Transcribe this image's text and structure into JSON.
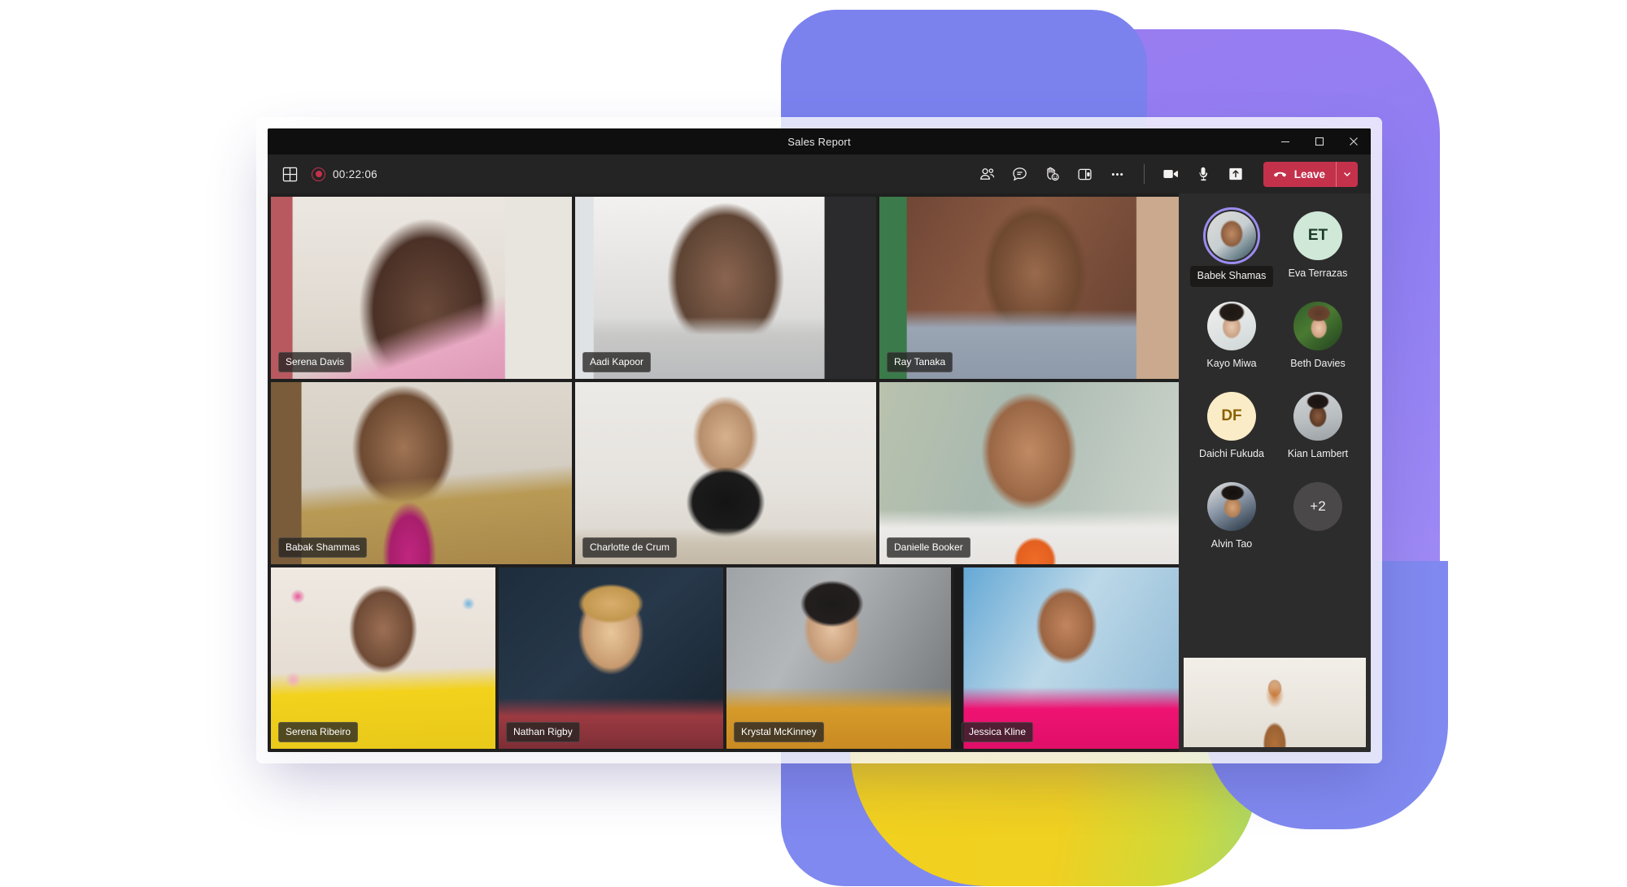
{
  "window": {
    "title": "Sales Report",
    "controls": [
      {
        "name": "minimize",
        "glyph": "minimize-icon"
      },
      {
        "name": "maximize",
        "glyph": "maximize-icon"
      },
      {
        "name": "close",
        "glyph": "close-icon"
      }
    ]
  },
  "toolbar": {
    "grid_view_icon": "grid-view-icon",
    "recording_icon": "record-icon",
    "elapsed_time": "00:22:06",
    "actions": [
      {
        "name": "people-icon",
        "label": "People"
      },
      {
        "name": "chat-icon",
        "label": "Chat"
      },
      {
        "name": "reactions-icon",
        "label": "Reactions"
      },
      {
        "name": "rooms-icon",
        "label": "Breakout rooms"
      },
      {
        "name": "more-icon",
        "label": "More actions"
      }
    ],
    "media": [
      {
        "name": "camera-icon",
        "label": "Camera"
      },
      {
        "name": "microphone-icon",
        "label": "Microphone"
      },
      {
        "name": "share-icon",
        "label": "Share"
      }
    ],
    "leave_label": "Leave",
    "leave_icon": "hangup-icon",
    "leave_dropdown_icon": "chevron-down-icon",
    "leave_color": "#c4314b"
  },
  "video_grid": {
    "rows": [
      [
        {
          "name": "Serena Davis",
          "bg": "#cfc4bc"
        },
        {
          "name": "Aadi Kapoor",
          "bg": "#b9bbbd"
        },
        {
          "name": "Ray Tanaka",
          "bg": "#7e5a48"
        }
      ],
      [
        {
          "name": "Babak Shammas",
          "bg": "#9a8b74"
        },
        {
          "name": "Charlotte de Crum",
          "bg": "#cfcac4"
        },
        {
          "name": "Danielle Booker",
          "bg": "#a6b0a4"
        }
      ],
      [
        {
          "name": "Serena Ribeiro",
          "bg": "#d8cfc5"
        },
        {
          "name": "Nathan Rigby",
          "bg": "#22303f"
        },
        {
          "name": "Krystal McKinney",
          "bg": "#8a8c8e"
        },
        {
          "name": "Jessica Kline",
          "bg": "#7fa8c9"
        }
      ]
    ]
  },
  "roster": {
    "participants": [
      {
        "name": "Babek Shamas",
        "type": "photo",
        "speaking": true,
        "label_style": "pill"
      },
      {
        "name": "Eva Terrazas",
        "type": "initials",
        "initials": "ET",
        "bg": "#cfe8d8",
        "fg": "#1b3a28"
      },
      {
        "name": "Kayo Miwa",
        "type": "photo",
        "speaking": false
      },
      {
        "name": "Beth Davies",
        "type": "photo",
        "speaking": false
      },
      {
        "name": "Daichi Fukuda",
        "type": "initials",
        "initials": "DF",
        "bg": "#fbecc8",
        "fg": "#8a6000"
      },
      {
        "name": "Kian Lambert",
        "type": "photo",
        "speaking": false
      },
      {
        "name": "Alvin Tao",
        "type": "photo",
        "speaking": false
      },
      {
        "name": "+2",
        "type": "overflow",
        "bg": "#4a4848",
        "fg": "#f0f0f0"
      }
    ],
    "speaking_ring_color": "#9a8df0"
  },
  "self_view": {
    "name": "self-video-preview"
  },
  "decor": {
    "purple": "#9a7cf0",
    "blue": "#7b82ee",
    "yellow": "#f2d11e",
    "green": "#a9d86a"
  }
}
